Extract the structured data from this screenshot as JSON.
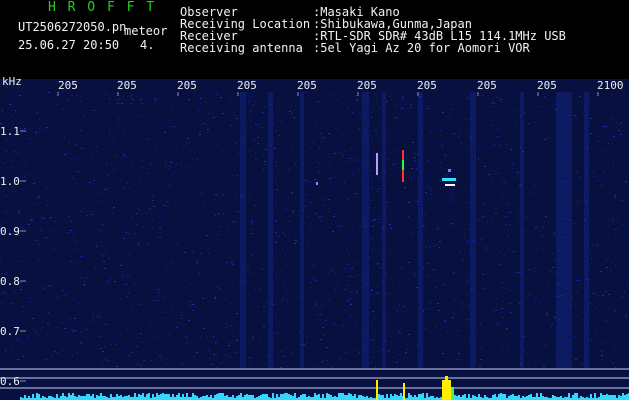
{
  "header": {
    "app_title": "H R O F F T",
    "file_name": "UT2506272050.pn",
    "mode": "meteor",
    "date_time": "25.06.27 20:50",
    "count": "4.",
    "meta": [
      {
        "label": "Observer",
        "value": ":Masaki Kano"
      },
      {
        "label": "Receiving Location",
        "value": ":Shibukawa,Gunma,Japan"
      },
      {
        "label": "Receiver",
        "value": ":RTL-SDR SDR# 43dB L15 114.1MHz USB"
      },
      {
        "label": "Receiving antenna",
        "value": ":5el Yagi Az 20 for Aomori VOR"
      }
    ]
  },
  "axes": {
    "y_unit": "kHz",
    "y_ticks": [
      "1.1",
      "1.0",
      "0.9",
      "0.8",
      "0.7",
      "0.6"
    ],
    "x_ticks": [
      "205",
      "205",
      "205",
      "205",
      "205",
      "205",
      "205",
      "205",
      "205",
      "2100"
    ]
  },
  "colors": {
    "background": "#000000",
    "spectrogram": "#0a1250",
    "accent_green": "#20d020",
    "signal_red": "#ff3030",
    "signal_cyan": "#30e0ff",
    "signal_yellow": "#ffee00",
    "text": "#f2f2f2"
  }
}
